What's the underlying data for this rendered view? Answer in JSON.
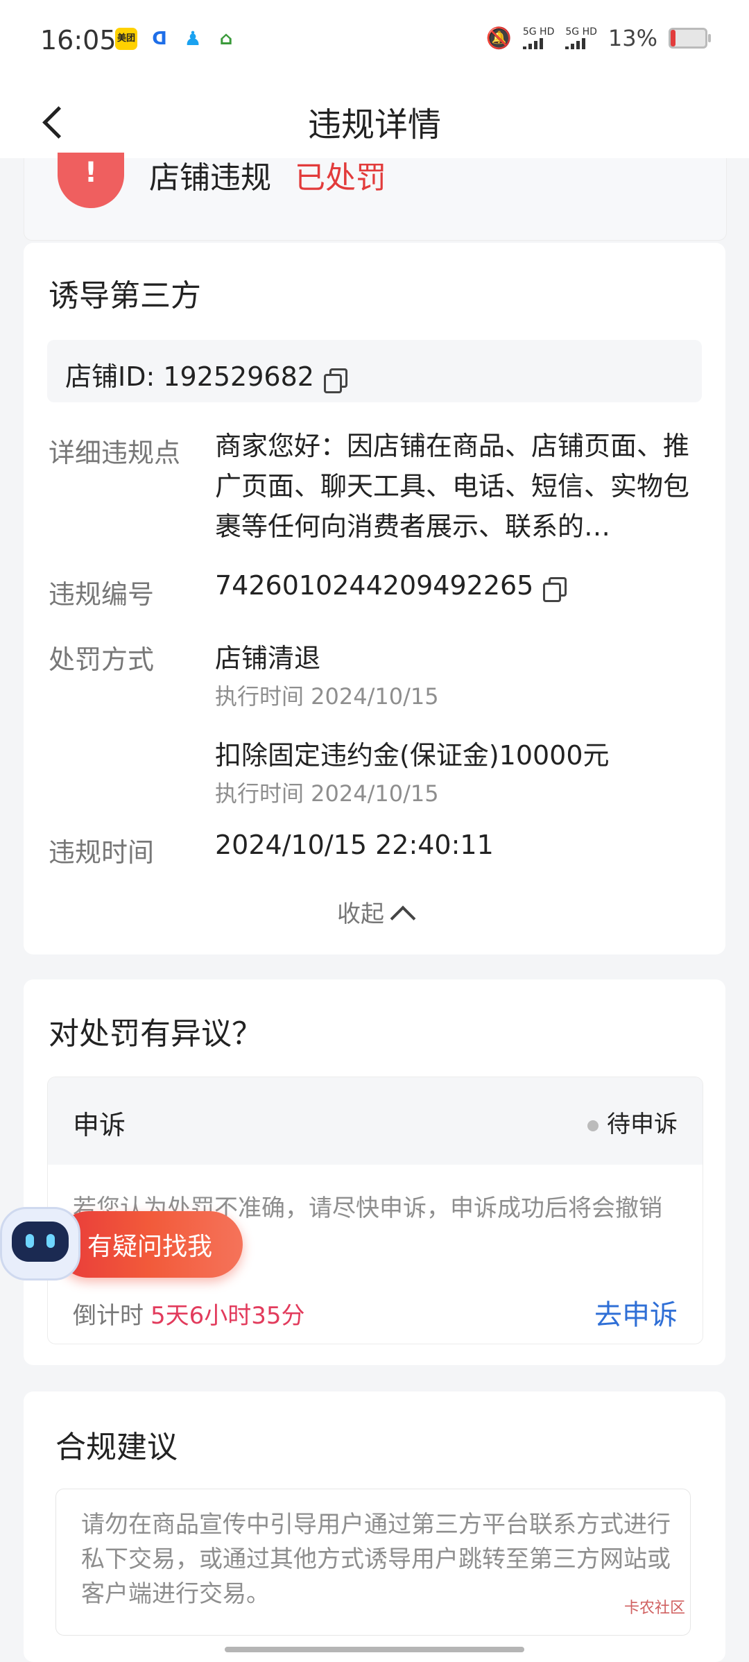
{
  "status_bar": {
    "time": "16:05",
    "apps": [
      {
        "name": "meituan-app-icon",
        "label": "美团",
        "color": "#ffd100"
      },
      {
        "name": "blue-app-icon",
        "label": "",
        "color": "#ffffff"
      },
      {
        "name": "qq-app-icon",
        "label": "",
        "color": "#ffffff"
      },
      {
        "name": "house-app-icon",
        "label": "",
        "color": "#ffffff"
      }
    ],
    "signal1": "5G HD",
    "signal2": "5G HD",
    "battery": "13%",
    "battery_level": 0.13
  },
  "nav": {
    "title": "违规详情"
  },
  "violation_header": {
    "label": "店铺违规",
    "status": "已处罚"
  },
  "detail": {
    "title": "诱导第三方",
    "shop_id": "店铺ID: 192529682",
    "rows": {
      "detail_label": "详细违规点",
      "detail_value": "商家您好：因店铺在商品、店铺页面、推广页面、聊天工具、电话、短信、实物包裹等任何向消费者展示、联系的…",
      "number_label": "违规编号",
      "number_value": "7426010244209492265",
      "penalty_label": "处罚方式",
      "penalty1": "店铺清退",
      "penalty1_time": "执行时间 2024/10/15",
      "penalty2": "扣除固定违约金(保证金)10000元",
      "penalty2_time": "执行时间 2024/10/15",
      "time_label": "违规时间",
      "time_value": "2024/10/15 22:40:11"
    },
    "collapse": "收起"
  },
  "appeal_section": {
    "title": "对处罚有异议？",
    "box_title": "申诉",
    "status": "待申诉",
    "desc": "若您认为处罚不准确，请尽快申诉，申诉成功后将会撤销",
    "countdown_label": "倒计时",
    "countdown_value": "5天6小时35分",
    "go_appeal": "去申诉"
  },
  "bot": {
    "label": "有疑问找我"
  },
  "compliance": {
    "title": "合规建议",
    "text": "请勿在商品宣传中引导用户通过第三方平台联系方式进行私下交易，或通过其他方式诱导用户跳转至第三方网站或客户端进行交易。"
  },
  "watermark": "卡农社区"
}
